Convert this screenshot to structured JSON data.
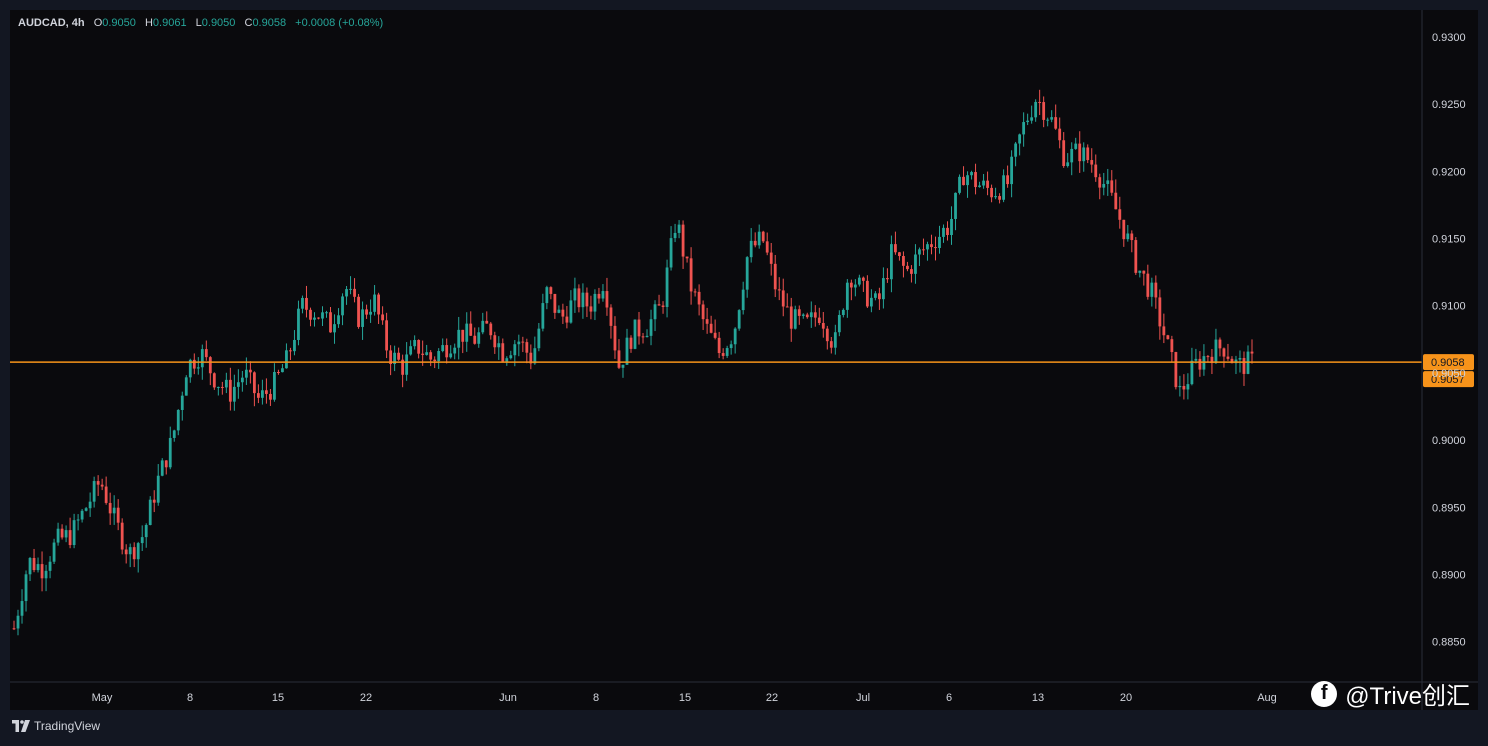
{
  "header": {
    "symbol": "AUDCAD, 4h",
    "open_label": "O",
    "open": "0.9050",
    "high_label": "H",
    "high": "0.9061",
    "low_label": "L",
    "low": "0.9050",
    "close_label": "C",
    "close": "0.9058",
    "change": "+0.0008 (+0.08%)"
  },
  "footer": {
    "brand": "TradingView"
  },
  "watermark": {
    "text": "@Trive创汇",
    "icon": "facebook-icon"
  },
  "colors": {
    "up": "#26a69a",
    "down": "#ef5350",
    "line": "#f7931a",
    "bg": "#0a0a0d",
    "axis_text": "#d1d4dc"
  },
  "chart_data": {
    "type": "candlestick",
    "ylim": [
      0.882,
      0.932
    ],
    "y_ticks": [
      "0.9300",
      "0.9250",
      "0.9200",
      "0.9150",
      "0.9100",
      "0.9050",
      "0.9000",
      "0.8950",
      "0.8900",
      "0.8850"
    ],
    "x_ticks": [
      "May",
      "8",
      "15",
      "22",
      "Jun",
      "8",
      "15",
      "22",
      "Jul",
      "6",
      "13",
      "20",
      "Aug"
    ],
    "horizontal_line": {
      "value": 0.9058,
      "label": "0.9058"
    },
    "price_labels": [
      "0.9058",
      "0.9057"
    ],
    "close_path": [
      [
        0,
        0.886
      ],
      [
        1,
        0.891
      ],
      [
        2,
        0.8905
      ],
      [
        3,
        0.8925
      ],
      [
        4,
        0.893
      ],
      [
        5,
        0.895
      ],
      [
        6,
        0.897
      ],
      [
        7,
        0.894
      ],
      [
        8,
        0.8915
      ],
      [
        9,
        0.893
      ],
      [
        10,
        0.897
      ],
      [
        11,
        0.9
      ],
      [
        12,
        0.9055
      ],
      [
        13,
        0.9065
      ],
      [
        14,
        0.9045
      ],
      [
        15,
        0.9035
      ],
      [
        16,
        0.905
      ],
      [
        17,
        0.903
      ],
      [
        18,
        0.904
      ],
      [
        19,
        0.906
      ],
      [
        20,
        0.91
      ],
      [
        21,
        0.9095
      ],
      [
        22,
        0.9085
      ],
      [
        23,
        0.9115
      ],
      [
        24,
        0.909
      ],
      [
        25,
        0.9105
      ],
      [
        26,
        0.9065
      ],
      [
        27,
        0.9055
      ],
      [
        28,
        0.907
      ],
      [
        29,
        0.906
      ],
      [
        30,
        0.907
      ],
      [
        31,
        0.908
      ],
      [
        32,
        0.9075
      ],
      [
        33,
        0.9085
      ],
      [
        34,
        0.9065
      ],
      [
        35,
        0.9075
      ],
      [
        36,
        0.906
      ],
      [
        37,
        0.911
      ],
      [
        38,
        0.909
      ],
      [
        39,
        0.9105
      ],
      [
        40,
        0.91
      ],
      [
        41,
        0.912
      ],
      [
        42,
        0.9055
      ],
      [
        43,
        0.908
      ],
      [
        44,
        0.9085
      ],
      [
        45,
        0.91
      ],
      [
        46,
        0.9165
      ],
      [
        47,
        0.9115
      ],
      [
        48,
        0.9085
      ],
      [
        49,
        0.9065
      ],
      [
        50,
        0.908
      ],
      [
        51,
        0.914
      ],
      [
        52,
        0.915
      ],
      [
        53,
        0.911
      ],
      [
        54,
        0.909
      ],
      [
        55,
        0.9085
      ],
      [
        56,
        0.9095
      ],
      [
        57,
        0.907
      ],
      [
        58,
        0.9125
      ],
      [
        59,
        0.911
      ],
      [
        60,
        0.91
      ],
      [
        61,
        0.914
      ],
      [
        62,
        0.9125
      ],
      [
        63,
        0.914
      ],
      [
        64,
        0.915
      ],
      [
        65,
        0.916
      ],
      [
        66,
        0.92
      ],
      [
        67,
        0.919
      ],
      [
        68,
        0.9185
      ],
      [
        69,
        0.919
      ],
      [
        70,
        0.923
      ],
      [
        71,
        0.9255
      ],
      [
        72,
        0.924
      ],
      [
        73,
        0.921
      ],
      [
        74,
        0.9215
      ],
      [
        75,
        0.9205
      ],
      [
        76,
        0.9185
      ],
      [
        77,
        0.916
      ],
      [
        78,
        0.913
      ],
      [
        79,
        0.911
      ],
      [
        80,
        0.9075
      ],
      [
        81,
        0.9035
      ],
      [
        82,
        0.9055
      ],
      [
        83,
        0.9065
      ],
      [
        84,
        0.907
      ],
      [
        85,
        0.9055
      ],
      [
        86,
        0.9058
      ]
    ]
  }
}
